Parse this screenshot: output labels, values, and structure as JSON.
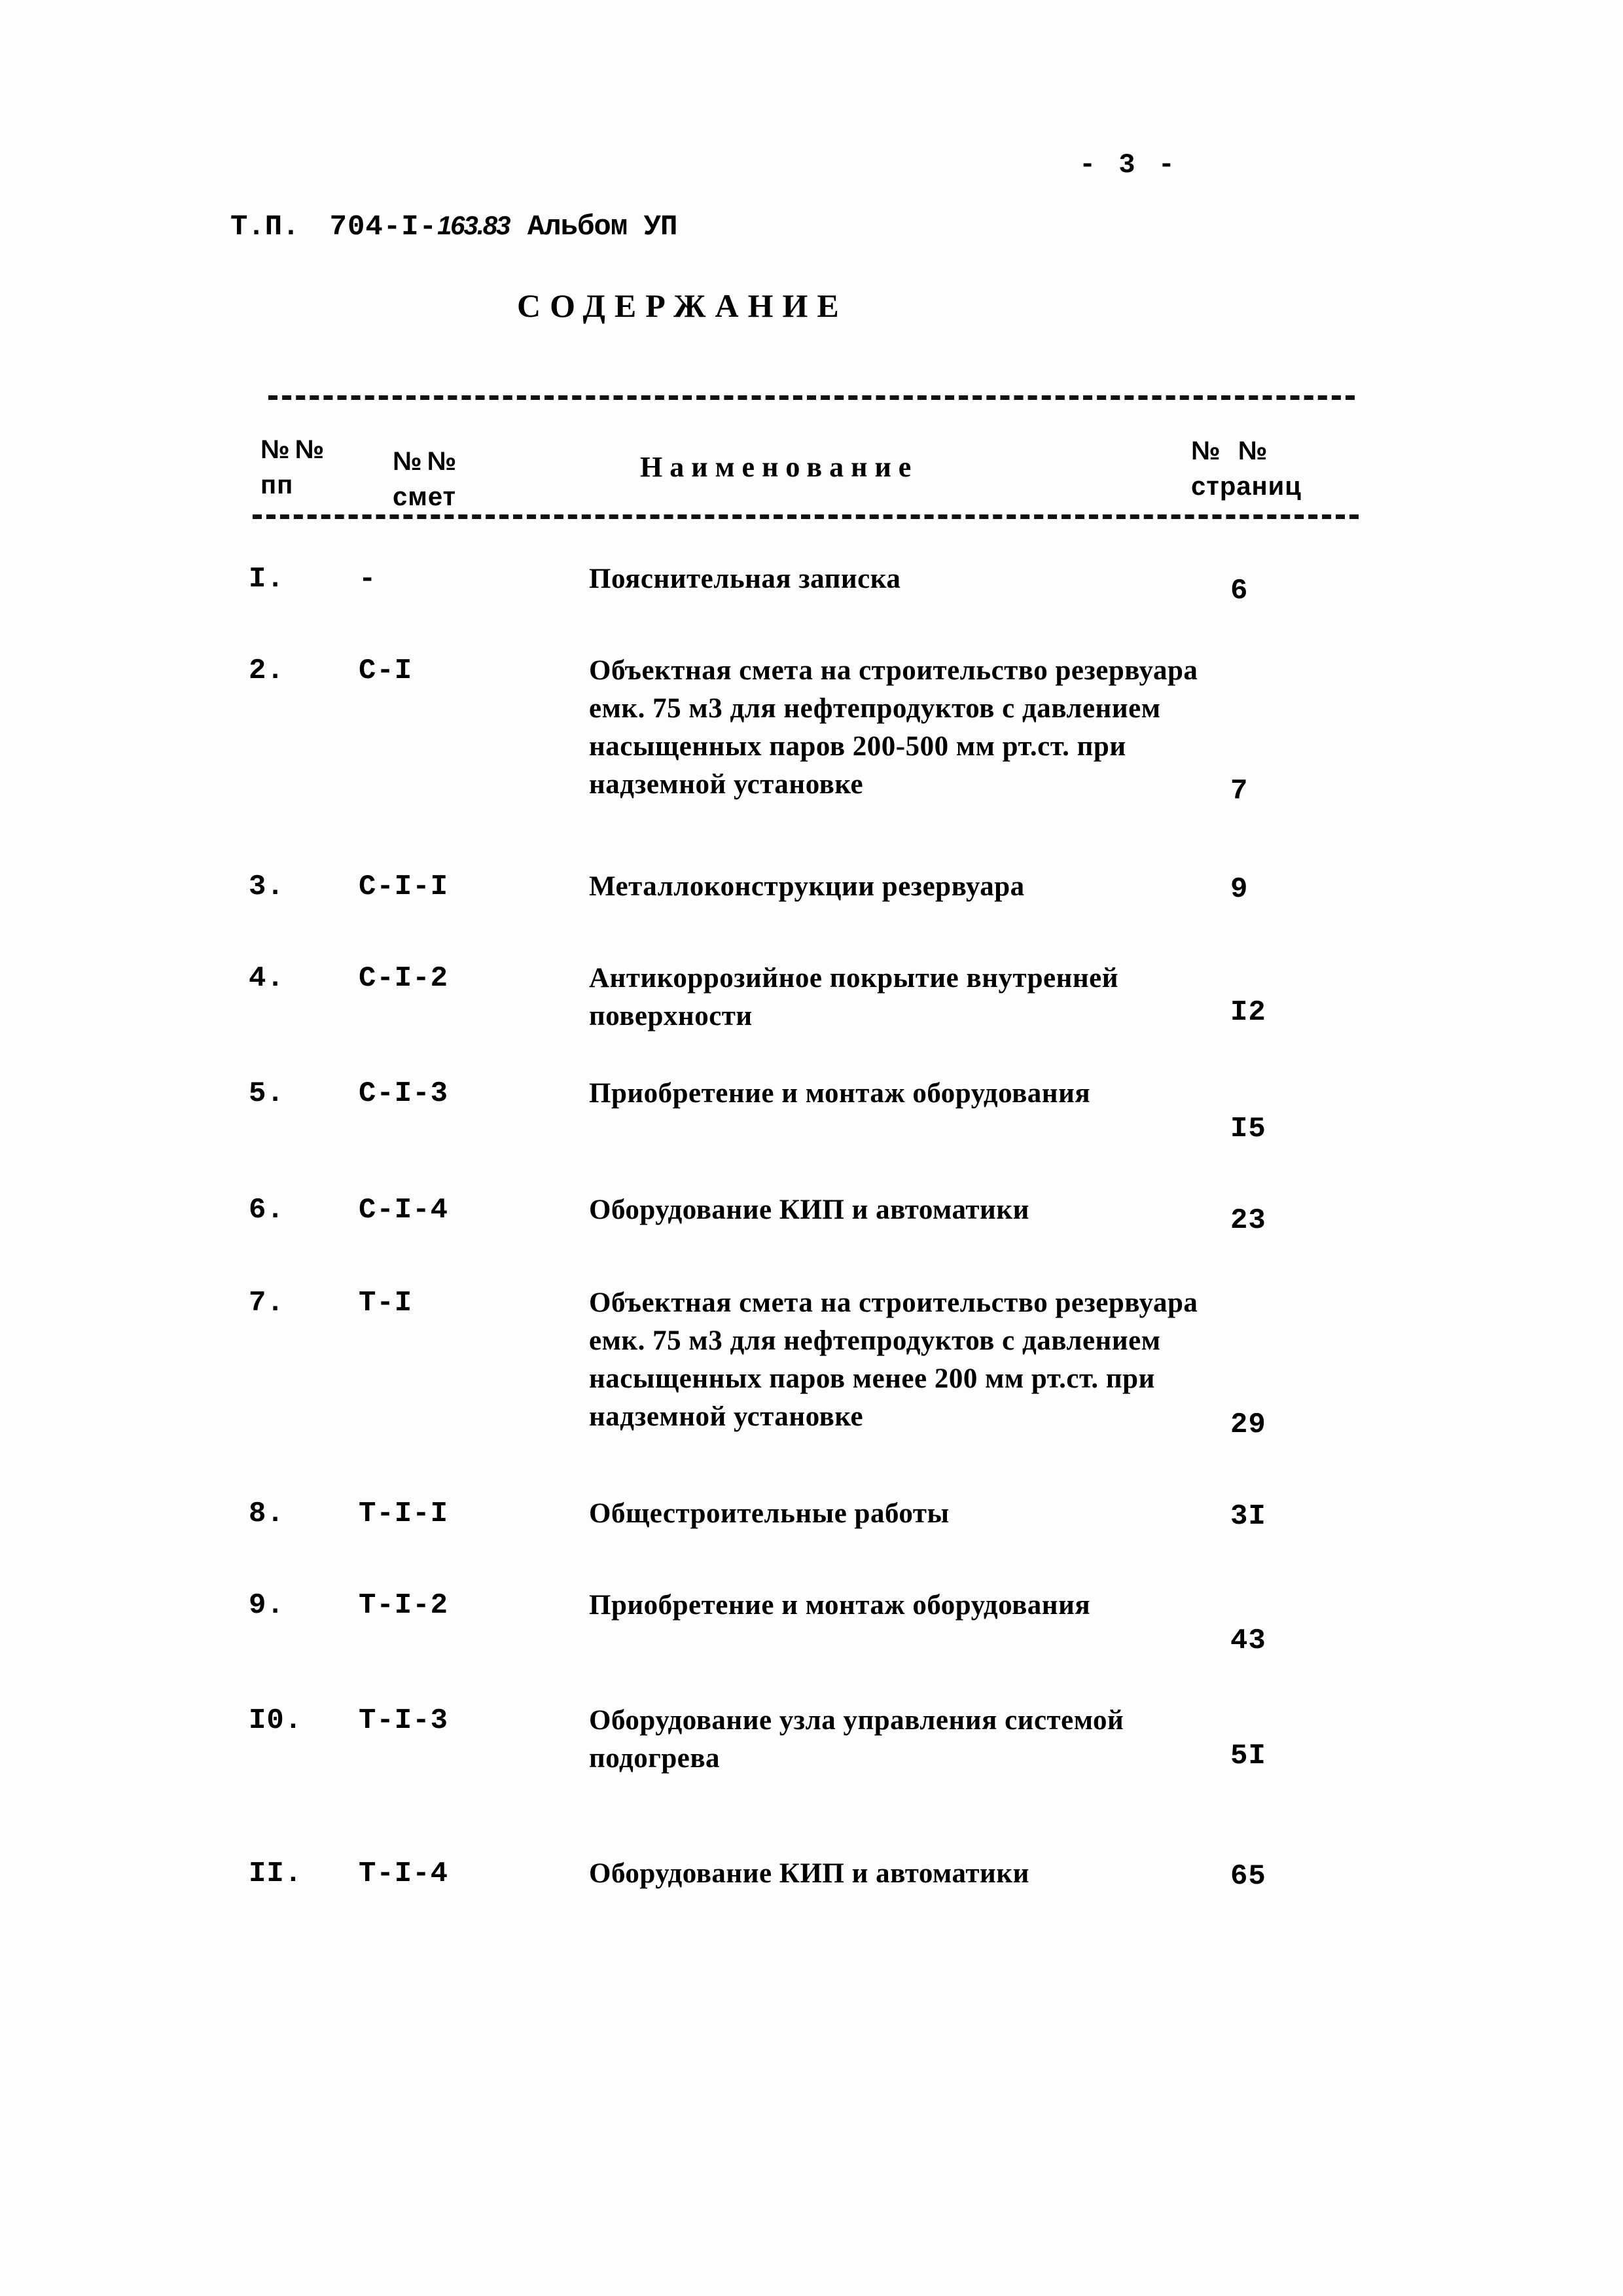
{
  "folio": "- 3 -",
  "doc_code": {
    "prefix": "Т.П.",
    "series": "704-I-",
    "serial": "163.83",
    "album": "Альбом УП"
  },
  "heading": "СОДЕРЖАНИЕ",
  "table": {
    "headers": {
      "num_line1": "№№",
      "num_line2": "пп",
      "est_line1": "№№",
      "est_line2": "смет",
      "name": "Наименование",
      "page_line1": "№ №",
      "page_line2": "страниц"
    },
    "rows": [
      {
        "num": "I.",
        "est": "-",
        "name": "Пояснительная записка",
        "page": "6"
      },
      {
        "num": "2.",
        "est": "C-I",
        "name": "Объектная смета на строительство резервуара емк. 75 м3 для нефтепродуктов с давлением насыщенных паров 200-500 мм рт.ст. при надземной установке",
        "page": "7"
      },
      {
        "num": "3.",
        "est": "C-I-I",
        "name": "Металлоконструкции резервуара",
        "page": "9"
      },
      {
        "num": "4.",
        "est": "C-I-2",
        "name": "Антикоррозийное покрытие внутренней поверхности",
        "page": "I2"
      },
      {
        "num": "5.",
        "est": "C-I-3",
        "name": "Приобретение и монтаж оборудования",
        "page": "I5"
      },
      {
        "num": "6.",
        "est": "C-I-4",
        "name": "Оборудование КИП и автоматики",
        "page": "23"
      },
      {
        "num": "7.",
        "est": "T-I",
        "name": "Объектная смета на строительство резервуара емк. 75 м3 для нефтепродуктов с давлением насыщенных паров менее 200 мм рт.ст. при надземной установке",
        "page": "29"
      },
      {
        "num": "8.",
        "est": "T-I-I",
        "name": "Общестроительные работы",
        "page": "3I"
      },
      {
        "num": "9.",
        "est": "T-I-2",
        "name": "Приобретение и монтаж оборудования",
        "page": "43"
      },
      {
        "num": "I0.",
        "est": "T-I-3",
        "name": "Оборудование узла управления системой подогрева",
        "page": "5I"
      },
      {
        "num": "II.",
        "est": "T-I-4",
        "name": "Оборудование КИП и автоматики",
        "page": "65"
      }
    ]
  },
  "row_layout": [
    {
      "top": 860,
      "name_top": 856,
      "page_top": 878
    },
    {
      "top": 1000,
      "name_top": 996,
      "page_top": 1184
    },
    {
      "top": 1330,
      "name_top": 1326,
      "page_top": 1334
    },
    {
      "top": 1470,
      "name_top": 1466,
      "page_top": 1522
    },
    {
      "top": 1646,
      "name_top": 1642,
      "page_top": 1700
    },
    {
      "top": 1824,
      "name_top": 1820,
      "page_top": 1840
    },
    {
      "top": 1966,
      "name_top": 1962,
      "page_top": 2152
    },
    {
      "top": 2288,
      "name_top": 2284,
      "page_top": 2292
    },
    {
      "top": 2428,
      "name_top": 2424,
      "page_top": 2482
    },
    {
      "top": 2604,
      "name_top": 2600,
      "page_top": 2658
    },
    {
      "top": 2838,
      "name_top": 2834,
      "page_top": 2842
    }
  ]
}
